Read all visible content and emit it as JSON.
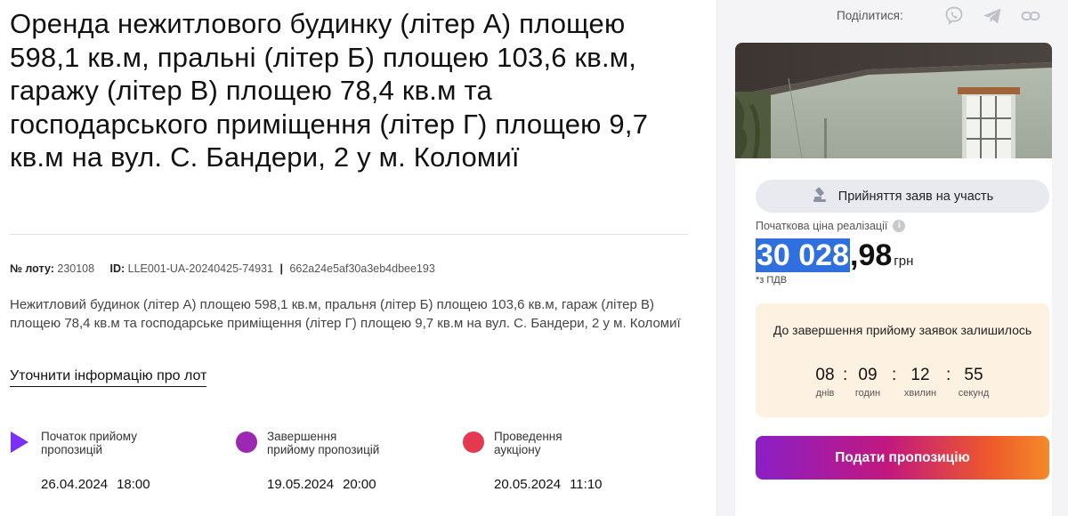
{
  "lot": {
    "title": "Оренда нежитлового будинку (літер А) площею 598,1 кв.м, пральні (літер Б) площею 103,6 кв.м, гаражу (літер В) площею 78,4 кв.м та господарського приміщення (літер Г) площею 9,7 кв.м на вул. С. Бандери, 2 у м. Коломиї",
    "number_label": "№ лоту:",
    "number_value": "230108",
    "id_label": "ID:",
    "id_value": "LLE001-UA-20240425-74931",
    "separator": "|",
    "hash": "662a24e5af30a3eb4dbee193",
    "description": "Нежитловий будинок (літер А) площею 598,1 кв.м, пральня (літер Б) площею 103,6 кв.м, гараж (літер В) площею 78,4 кв.м та господарське приміщення (літер Г) площею 9,7 кв.м на вул. С. Бандери, 2 у м. Коломиї",
    "clarify_link": "Уточнити інформацію про лот"
  },
  "phases": [
    {
      "label": "Початок прийому пропозицій",
      "date": "26.04.2024",
      "time": "18:00",
      "color": "#7b2ff7",
      "marker": "play-icon"
    },
    {
      "label": "Завершення прийому пропозицій",
      "date": "19.05.2024",
      "time": "20:00",
      "color": "#9c27b0",
      "marker": "circle-icon"
    },
    {
      "label": "Проведення аукціону",
      "date": "20.05.2024",
      "time": "11:10",
      "color": "#e53950",
      "marker": "circle-icon"
    }
  ],
  "share": {
    "label": "Поділитися:",
    "icons": [
      "viber-icon",
      "telegram-icon",
      "link-icon"
    ]
  },
  "sidebar": {
    "status_pill": "Прийняття заяв на участь",
    "status_icon": "gavel-icon",
    "price_label": "Початкова ціна реалізації",
    "price_whole": "30 028",
    "price_fraction": ",98",
    "price_currency": "грн",
    "vat_note": "*з ПДВ",
    "timer_title": "До завершення прийому заявок залишилось",
    "timer": [
      {
        "value": "08",
        "unit": "днів"
      },
      {
        "value": "09",
        "unit": "годин"
      },
      {
        "value": "12",
        "unit": "хвилин"
      },
      {
        "value": "55",
        "unit": "секунд"
      }
    ],
    "offer_button": "Подати пропозицію"
  },
  "colors": {
    "accent_selection": "#2f6fde",
    "timer_bg": "#fdf1e1",
    "sidebar_bg": "#f4f4f6",
    "pill_bg": "#e9eaf0",
    "button_gradient_start": "#8a1fc7",
    "button_gradient_end": "#f58a2a"
  }
}
